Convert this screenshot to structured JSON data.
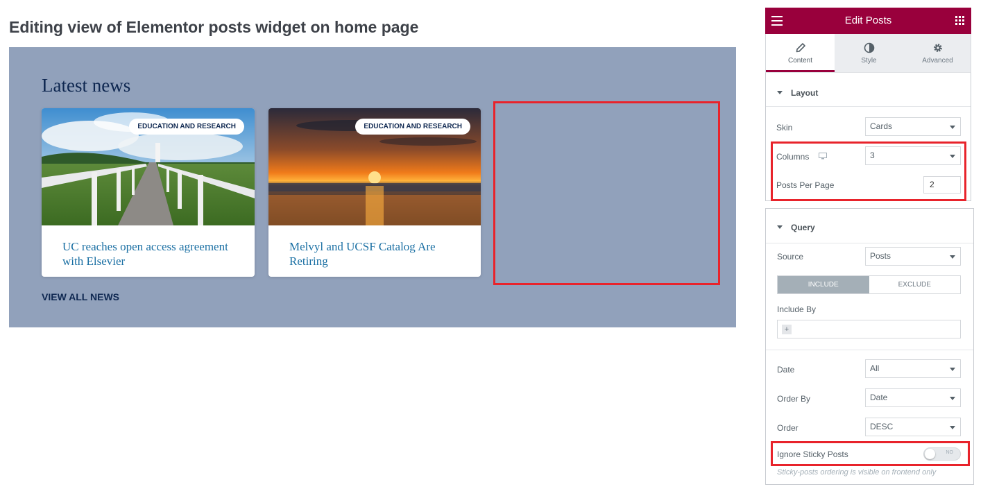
{
  "page_title": "Editing view of Elementor posts widget on home page",
  "preview": {
    "heading": "Latest news",
    "cards": [
      {
        "badge": "EDUCATION AND RESEARCH",
        "title": "UC reaches open access agreement with Elsevier"
      },
      {
        "badge": "EDUCATION AND RESEARCH",
        "title": "Melvyl and UCSF Catalog Are Retiring"
      }
    ],
    "view_all": "VIEW ALL NEWS"
  },
  "panel": {
    "title": "Edit Posts",
    "tabs": [
      {
        "label": "Content",
        "icon": "pencil-icon",
        "active": true
      },
      {
        "label": "Style",
        "icon": "half-circle-icon",
        "active": false
      },
      {
        "label": "Advanced",
        "icon": "gear-icon",
        "active": false
      }
    ],
    "layout": {
      "title": "Layout",
      "skin_label": "Skin",
      "skin_value": "Cards",
      "columns_label": "Columns",
      "columns_value": "3",
      "posts_per_page_label": "Posts Per Page",
      "posts_per_page_value": "2"
    },
    "query": {
      "title": "Query",
      "source_label": "Source",
      "source_value": "Posts",
      "include_label": "INCLUDE",
      "exclude_label": "EXCLUDE",
      "include_by_label": "Include By",
      "date_label": "Date",
      "date_value": "All",
      "order_by_label": "Order By",
      "order_by_value": "Date",
      "order_label": "Order",
      "order_value": "DESC",
      "ignore_sticky_label": "Ignore Sticky Posts",
      "ignore_sticky_value": "NO",
      "hint": "Sticky-posts ordering is visible on frontend only"
    }
  },
  "colors": {
    "accent": "#99003c",
    "highlight": "#e8232b",
    "preview_bg": "#91a1bb",
    "heading": "#0e2750",
    "link": "#1a6fa3"
  }
}
